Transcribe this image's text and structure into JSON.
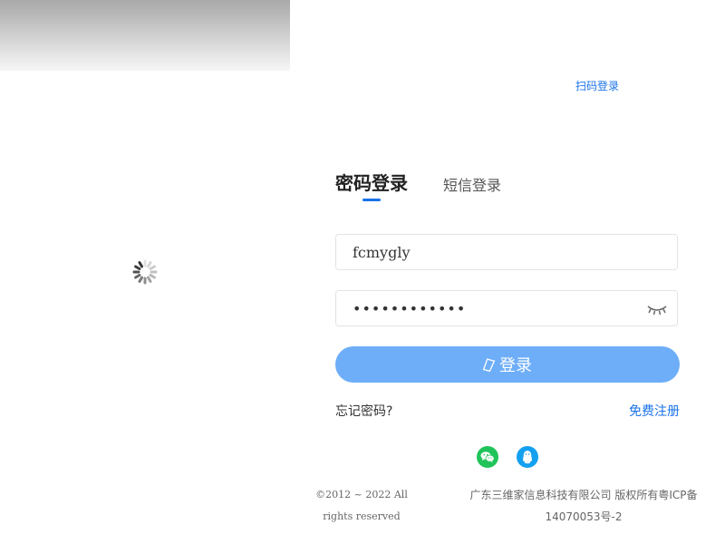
{
  "header": {
    "qr_login_label": "扫码登录"
  },
  "tabs": [
    {
      "label": "密码登录",
      "active": true
    },
    {
      "label": "短信登录",
      "active": false
    }
  ],
  "form": {
    "username_value": "fcmygly",
    "password_value": "fcmygly12345",
    "login_label": "登录",
    "forgot_label": "忘记密码?",
    "register_label": "免费注册"
  },
  "social": {
    "wechat_icon": "wechat-icon",
    "qq_icon": "qq-icon"
  },
  "footer": {
    "copyright": "©2012 ~ 2022 All rights reserved",
    "company": "广东三维家信息科技有限公司 版权所有粤ICP备14070053号-2"
  },
  "colors": {
    "accent": "#1a73e8",
    "button": "#6eaef8",
    "wechat": "#21c45a",
    "qq": "#14a0f0"
  }
}
